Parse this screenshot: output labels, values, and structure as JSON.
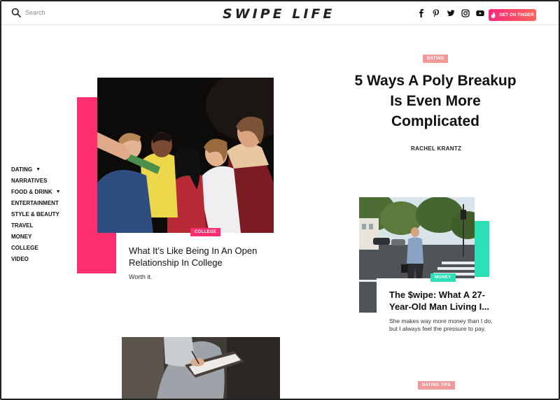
{
  "header": {
    "search_placeholder": "Search",
    "logo": "SWIPE LIFE",
    "social_icons": [
      "facebook-icon",
      "pinterest-icon",
      "twitter-icon",
      "instagram-icon",
      "youtube-icon"
    ],
    "cta_label": "GET ON TINDER"
  },
  "nav": {
    "items": [
      {
        "label": "DATING",
        "caret": "▼"
      },
      {
        "label": "NARRATIVES"
      },
      {
        "label": "FOOD & DRINK",
        "caret": "▼"
      },
      {
        "label": "ENTERTAINMENT"
      },
      {
        "label": "STYLE & BEAUTY"
      },
      {
        "label": "TRAVEL"
      },
      {
        "label": "MONEY"
      },
      {
        "label": "COLLEGE"
      },
      {
        "label": "VIDEO"
      }
    ]
  },
  "hero": {
    "category": "COLLEGE",
    "title": "What It’s Like Being In An Open Relationship In College",
    "subtitle": "Worth it."
  },
  "feature": {
    "category": "DATING",
    "title": "5 Ways A Poly Breakup Is Even More Complicated",
    "author": "RACHEL KRANTZ"
  },
  "secondary": {
    "category": "MONEY",
    "title": "The $wipe: What A 27-Year-Old Man Living I...",
    "subtitle": "She makes way more money than I do, but I always feel the pressure to pay."
  },
  "bottom": {
    "category": "DATING TIPS"
  },
  "colors": {
    "pink": "#fd2e6e",
    "teal": "#2bdfb6",
    "salmon": "#f29a9a",
    "tinder_gradient_start": "#fd297b",
    "tinder_gradient_end": "#ff655b"
  }
}
